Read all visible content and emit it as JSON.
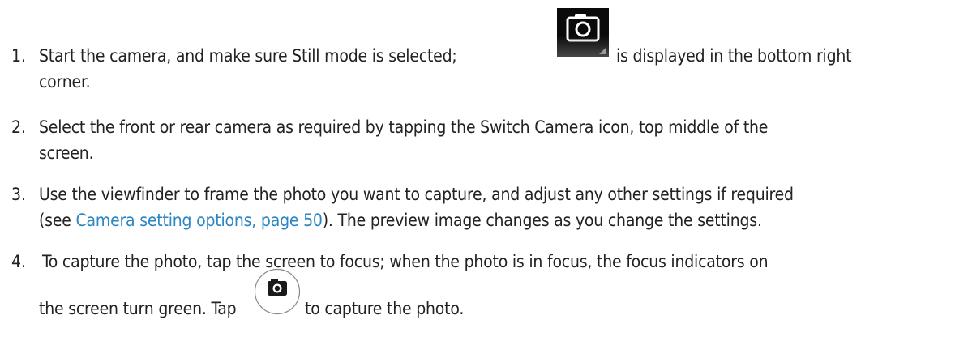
{
  "steps": [
    {
      "number": "1.",
      "lines": [
        "Start the camera, and make sure Still mode is selected;",
        "is displayed in the bottom right",
        "corner."
      ],
      "icon": "still-mode-camera-icon"
    },
    {
      "number": "2.",
      "lines": [
        "Select the front or rear camera as required by tapping the Switch Camera icon, top middle of the",
        "screen."
      ]
    },
    {
      "number": "3.",
      "lines": [
        "Use the viewfinder to frame the photo you want to capture, and adjust any other settings if required",
        "(see ",
        "Camera setting options, page 50",
        "). The preview image changes as you change the settings."
      ]
    },
    {
      "number": "4.",
      "lines": [
        "To capture the photo, tap the screen to focus; when the photo is in focus, the focus indicators on",
        "the screen turn green. Tap",
        "to capture the photo."
      ],
      "icon": "shutter-button-icon"
    }
  ],
  "colors": {
    "text": "#222222",
    "link": "#2b86c2"
  }
}
